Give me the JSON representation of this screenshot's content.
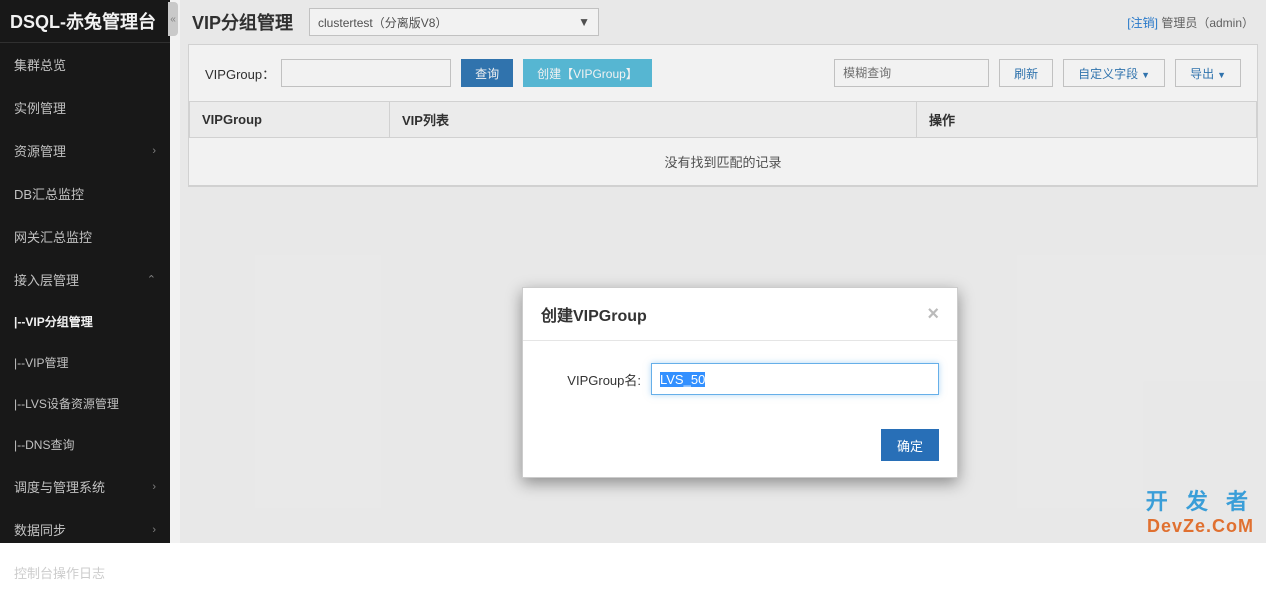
{
  "brand": "DSQL-赤兔管理台",
  "sidebar": {
    "items": [
      {
        "label": "集群总览",
        "chevron": ""
      },
      {
        "label": "实例管理",
        "chevron": ""
      },
      {
        "label": "资源管理",
        "chevron": "›"
      },
      {
        "label": "DB汇总监控",
        "chevron": ""
      },
      {
        "label": "网关汇总监控",
        "chevron": ""
      },
      {
        "label": "接入层管理",
        "chevron": "⌃"
      },
      {
        "label": "|--VIP分组管理",
        "chevron": ""
      },
      {
        "label": "|--VIP管理",
        "chevron": ""
      },
      {
        "label": "|--LVS设备资源管理",
        "chevron": ""
      },
      {
        "label": "|--DNS查询",
        "chevron": ""
      },
      {
        "label": "调度与管理系统",
        "chevron": "›"
      },
      {
        "label": "数据同步",
        "chevron": "›"
      },
      {
        "label": "控制台操作日志",
        "chevron": ""
      }
    ]
  },
  "header": {
    "title": "VIP分组管理",
    "cluster": "clustertest（分离版V8）",
    "logout": "[注销]",
    "user": "管理员（admin）"
  },
  "toolbar": {
    "label": "VIPGroup：",
    "query_btn": "查询",
    "create_btn": "创建【VIPGroup】",
    "search_placeholder": "模糊查询",
    "refresh_btn": "刷新",
    "custom_fields_btn": "自定义字段",
    "export_btn": "导出"
  },
  "table": {
    "col1": "VIPGroup",
    "col2": "VIP列表",
    "col3": "操作",
    "no_records": "没有找到匹配的记录"
  },
  "modal": {
    "title": "创建VIPGroup",
    "label": "VIPGroup名:",
    "value": "LVS_50",
    "confirm": "确定"
  },
  "watermark": {
    "cn": "开 发 者",
    "en": "DevZe.CoM"
  }
}
